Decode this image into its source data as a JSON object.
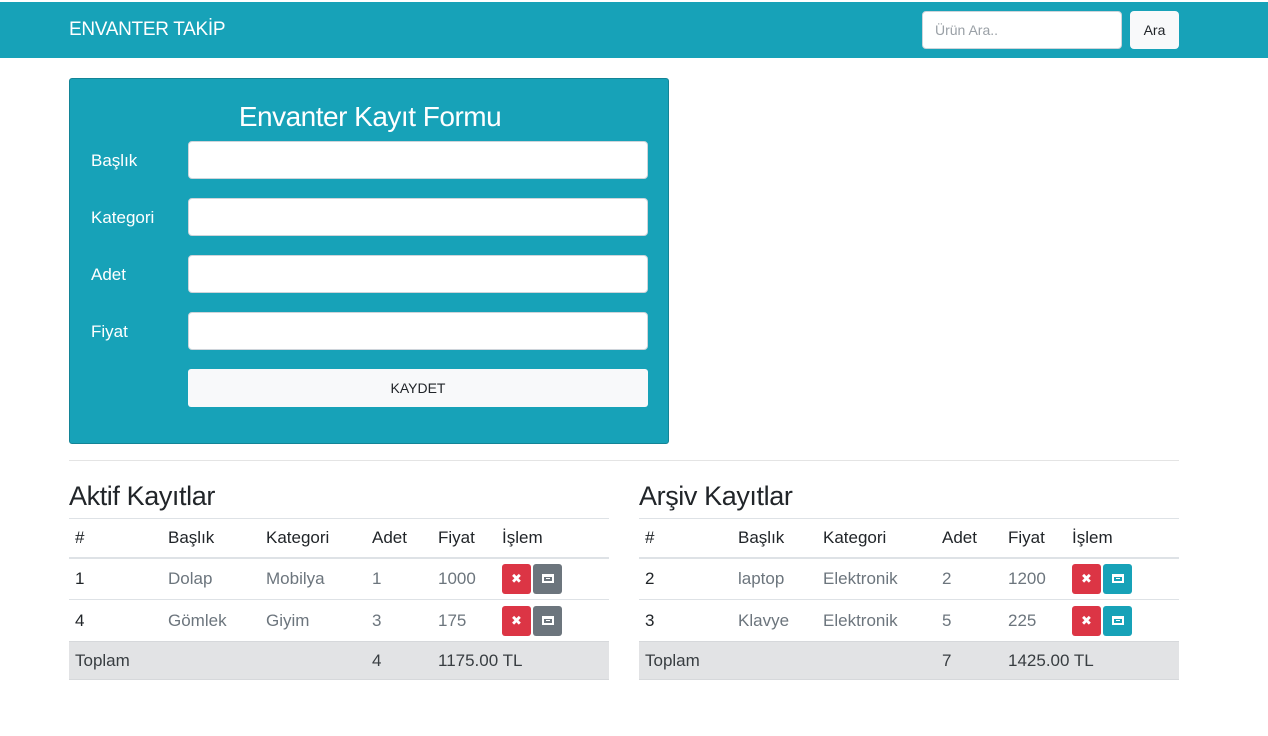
{
  "navbar": {
    "brand": "ENVANTER TAKİP",
    "search_placeholder": "Ürün Ara..",
    "search_button": "Ara"
  },
  "form": {
    "title": "Envanter Kayıt Formu",
    "fields": [
      {
        "label": "Başlık",
        "value": ""
      },
      {
        "label": "Kategori",
        "value": ""
      },
      {
        "label": "Adet",
        "value": ""
      },
      {
        "label": "Fiyat",
        "value": ""
      }
    ],
    "save_button": "KAYDET"
  },
  "active": {
    "title": "Aktif Kayıtlar",
    "headers": [
      "#",
      "Başlık",
      "Kategori",
      "Adet",
      "Fiyat",
      "İşlem"
    ],
    "rows": [
      {
        "id": "1",
        "title": "Dolap",
        "category": "Mobilya",
        "qty": "1",
        "price": "1000"
      },
      {
        "id": "4",
        "title": "Gömlek",
        "category": "Giyim",
        "qty": "3",
        "price": "175"
      }
    ],
    "total": {
      "label": "Toplam",
      "qty": "4",
      "price": "1175.00 TL"
    }
  },
  "archive": {
    "title": "Arşiv Kayıtlar",
    "headers": [
      "#",
      "Başlık",
      "Kategori",
      "Adet",
      "Fiyat",
      "İşlem"
    ],
    "rows": [
      {
        "id": "2",
        "title": "laptop",
        "category": "Elektronik",
        "qty": "2",
        "price": "1200"
      },
      {
        "id": "3",
        "title": "Klavye",
        "category": "Elektronik",
        "qty": "5",
        "price": "225"
      }
    ],
    "total": {
      "label": "Toplam",
      "qty": "7",
      "price": "1425.00 TL"
    }
  },
  "icons": {
    "delete": "times-icon",
    "archive": "archive-box-icon"
  }
}
